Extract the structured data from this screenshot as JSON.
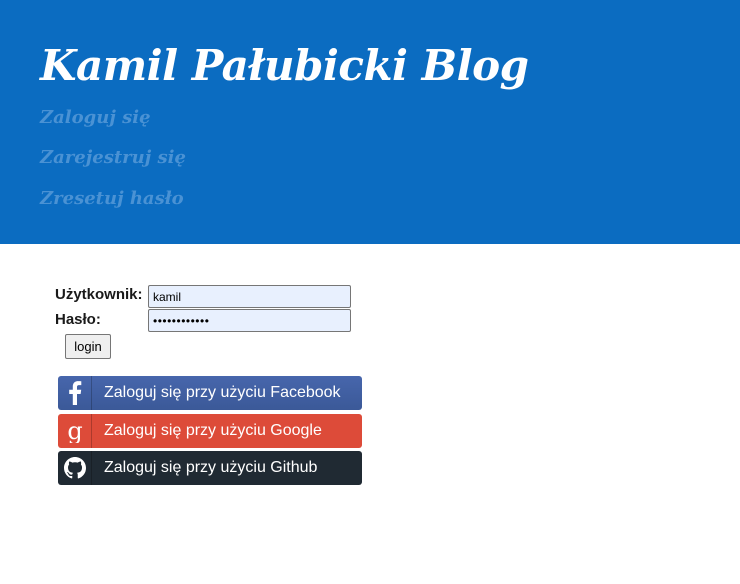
{
  "header": {
    "title": "Kamil Pałubicki Blog",
    "nav": [
      "Zaloguj się",
      "Zarejestruj się",
      "Zresetuj hasło"
    ],
    "background_color": "#0b6cc1",
    "nav_color": "#4a92d4"
  },
  "login_form": {
    "username_label": "Użytkownik:",
    "password_label": "Hasło:",
    "username_value": "kamil",
    "password_value": "••••••••••••",
    "login_button": "login"
  },
  "social_logins": [
    {
      "label": "Zaloguj się przy użyciu Facebook",
      "icon": "facebook-icon",
      "color": "#3b5998"
    },
    {
      "label": "Zaloguj się przy użyciu Google",
      "icon": "google-plus-icon",
      "color": "#dd4b39"
    },
    {
      "label": "Zaloguj się przy użyciu Github",
      "icon": "github-icon",
      "color": "#202a33"
    }
  ]
}
